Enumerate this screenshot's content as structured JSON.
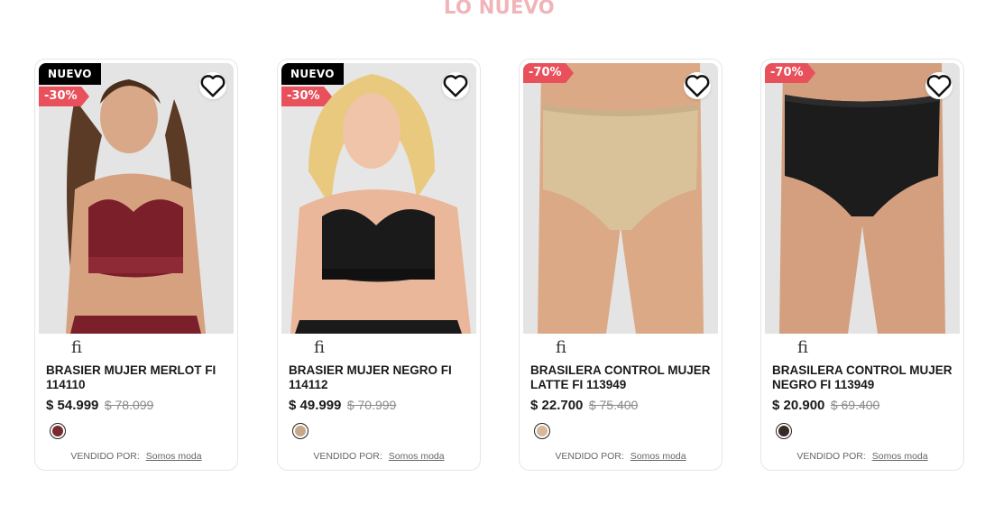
{
  "section": {
    "title": "LO NUEVO"
  },
  "products": [
    {
      "badge_new": "NUEVO",
      "discount": "-30%",
      "brand": "fi",
      "name": "BRASIER MUJER MERLOT FI 114110",
      "price": "$ 54.999",
      "old_price": "$ 78.099",
      "seller_label": "VENDIDO POR:",
      "seller_name": "Somos moda",
      "swatch_color": "#7a2a2a",
      "product_color": "#7b1f2b",
      "product_type": "bra"
    },
    {
      "badge_new": "NUEVO",
      "discount": "-30%",
      "brand": "fi",
      "name": "BRASIER MUJER NEGRO FI 114112",
      "price": "$ 49.999",
      "old_price": "$ 70.999",
      "seller_label": "VENDIDO POR:",
      "seller_name": "Somos moda",
      "swatch_color": "#c9a88a",
      "product_color": "#1a1a1a",
      "product_type": "bra"
    },
    {
      "badge_new": "",
      "discount": "-70%",
      "brand": "fi",
      "name": "BRASILERA CONTROL MUJER LATTE FI 113949",
      "price": "$ 22.700",
      "old_price": "$ 75.400",
      "seller_label": "VENDIDO POR:",
      "seller_name": "Somos moda",
      "swatch_color": "#d8b89a",
      "product_color": "#d9c29a",
      "product_type": "brief"
    },
    {
      "badge_new": "",
      "discount": "-70%",
      "brand": "fi",
      "name": "BRASILERA CONTROL MUJER NEGRO FI 113949",
      "price": "$ 20.900",
      "old_price": "$ 69.400",
      "seller_label": "VENDIDO POR:",
      "seller_name": "Somos moda",
      "swatch_color": "#3a2a26",
      "product_color": "#1c1c1c",
      "product_type": "brief"
    }
  ]
}
